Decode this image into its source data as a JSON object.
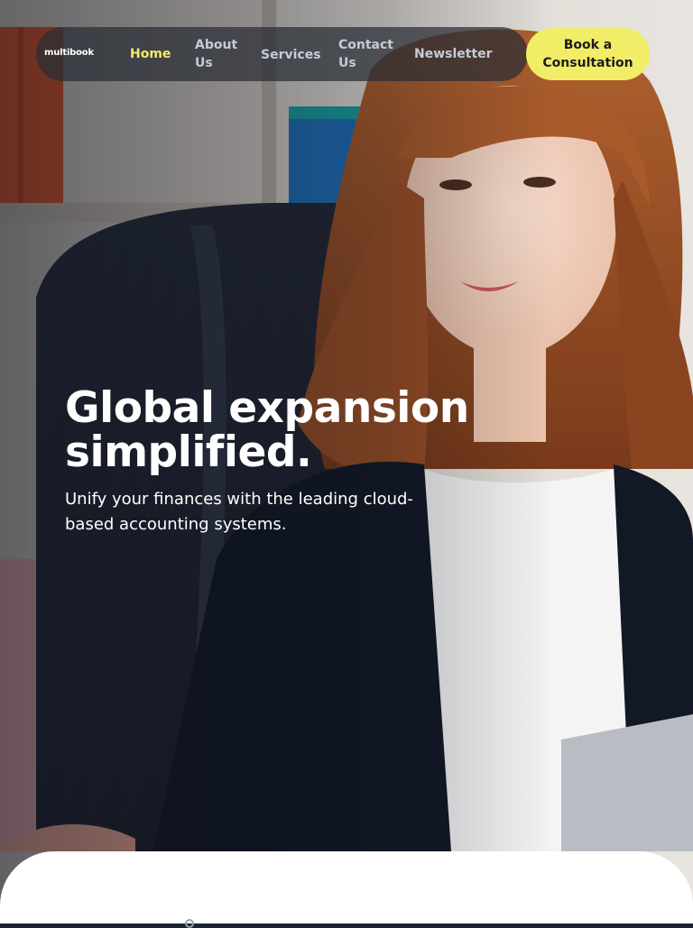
{
  "brand": {
    "name": "multibook"
  },
  "nav": {
    "items": [
      {
        "label": "Home",
        "active": true
      },
      {
        "label": "About Us",
        "active": false
      },
      {
        "label": "Services",
        "active": false
      },
      {
        "label": "Contact Us",
        "active": false
      },
      {
        "label": "Newsletter",
        "active": false
      }
    ],
    "cta_label": "Book a Consultation"
  },
  "hero": {
    "headline": "Global expansion simplified.",
    "subheadline": "Unify your finances with the leading cloud-based accounting systems.",
    "image": "woman-in-office-chair-photo"
  },
  "colors": {
    "accent": "#f2ed67",
    "active_link": "#f2ec6b",
    "nav_link": "#c7cbd6",
    "nav_bg": "#282c34",
    "text_light": "#ffffff",
    "panel_bg": "#ffffff"
  }
}
